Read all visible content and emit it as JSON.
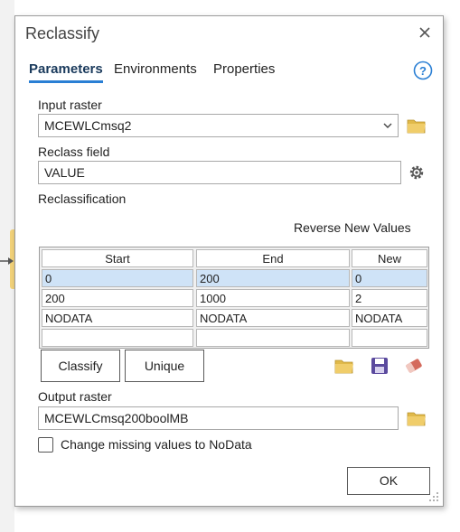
{
  "dialog": {
    "title": "Reclassify"
  },
  "tabs": [
    {
      "label": "Parameters",
      "active": true
    },
    {
      "label": "Environments",
      "active": false
    },
    {
      "label": "Properties",
      "active": false
    }
  ],
  "input_raster": {
    "label": "Input raster",
    "value": "MCEWLCmsq2"
  },
  "reclass_field": {
    "label": "Reclass field",
    "value": "VALUE"
  },
  "reclassification": {
    "label": "Reclassification",
    "reverse_label": "Reverse New Values",
    "columns": [
      "Start",
      "End",
      "New"
    ],
    "rows": [
      [
        "0",
        "200",
        "0"
      ],
      [
        "200",
        "1000",
        "2"
      ],
      [
        "NODATA",
        "NODATA",
        "NODATA"
      ],
      [
        "",
        "",
        ""
      ]
    ]
  },
  "buttons": {
    "classify": "Classify",
    "unique": "Unique",
    "ok": "OK"
  },
  "output_raster": {
    "label": "Output raster",
    "value": "MCEWLCmsq200boolMB"
  },
  "missing_values": {
    "label": "Change missing values to NoData",
    "checked": false
  },
  "colors": {
    "accent": "#2a7fd4",
    "folder": "#e0b94a",
    "save": "#5b4a9e",
    "eraser": "#d46a5c",
    "selected_row": "#cfe3f7"
  }
}
